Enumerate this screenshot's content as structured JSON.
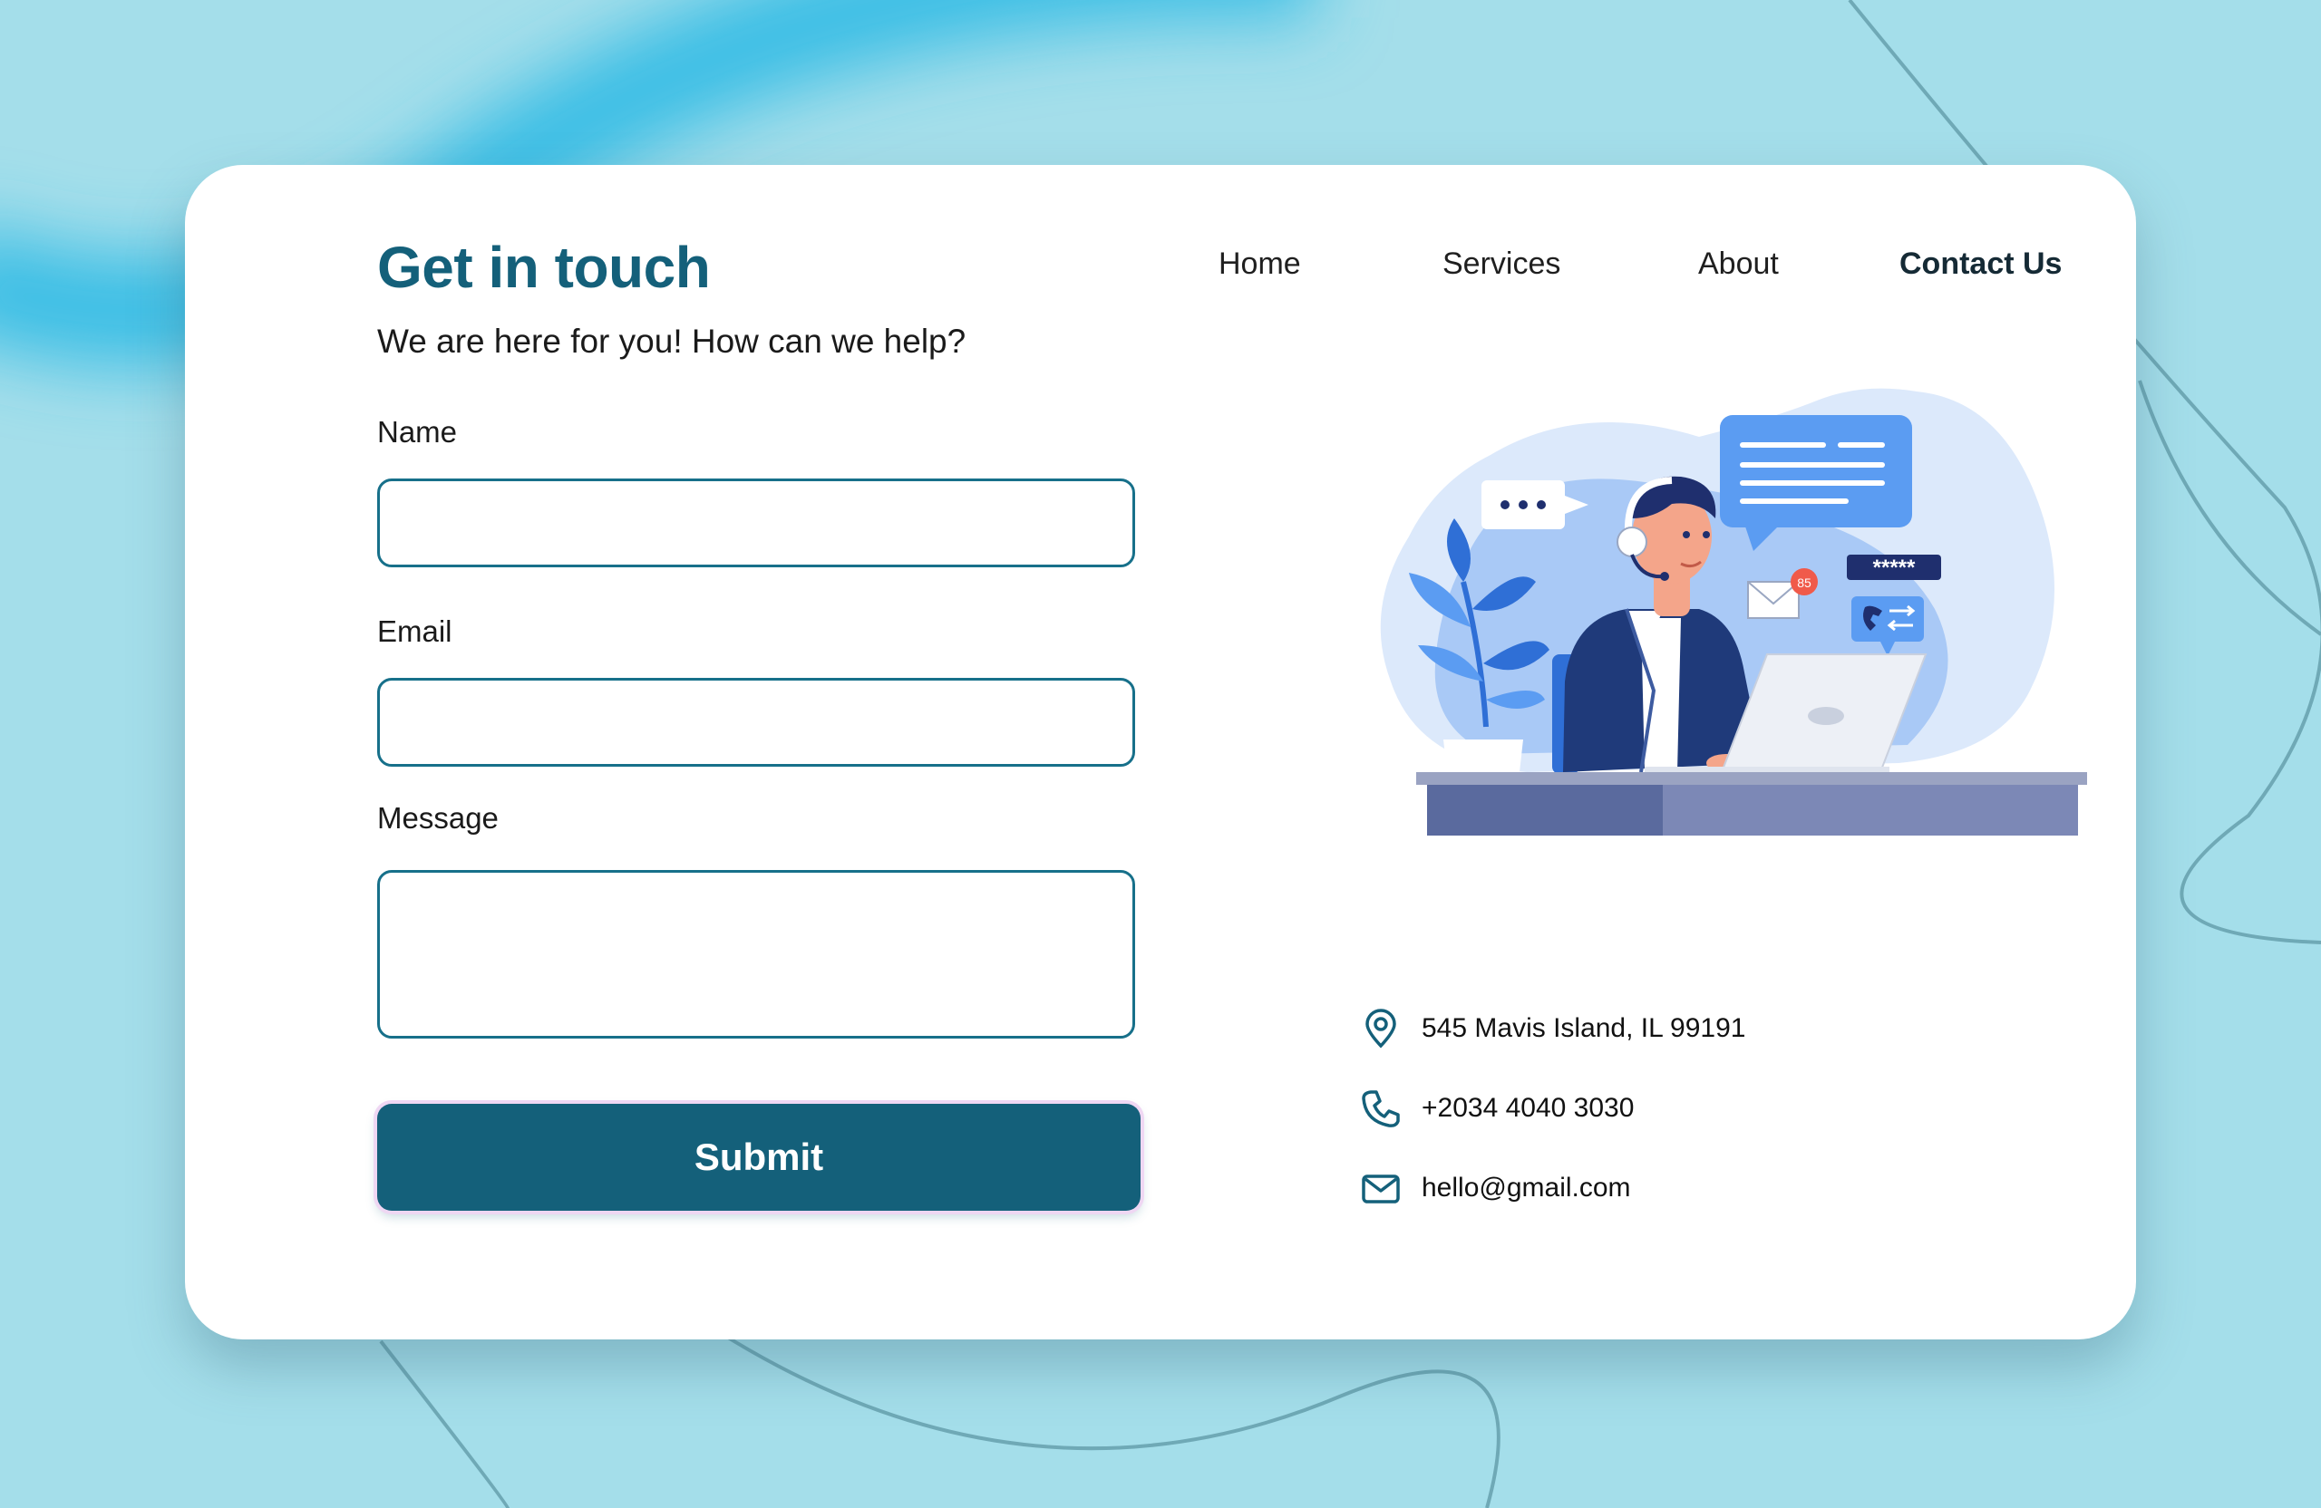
{
  "header": {
    "title": "Get in touch",
    "subtitle": "We are here for you! How can we help?"
  },
  "nav": {
    "items": [
      {
        "label": "Home"
      },
      {
        "label": "Services"
      },
      {
        "label": "About"
      },
      {
        "label": "Contact Us",
        "active": true
      }
    ]
  },
  "form": {
    "name_label": "Name",
    "name_value": "",
    "email_label": "Email",
    "email_value": "",
    "message_label": "Message",
    "message_value": "",
    "submit_label": "Submit"
  },
  "illustration": {
    "password_mask": "*****",
    "notification_count": "85"
  },
  "contact": {
    "address": "545 Mavis Island, IL 99191",
    "phone": "+2034 4040 3030",
    "email": "hello@gmail.com"
  },
  "colors": {
    "background": "#a4deea",
    "card": "#ffffff",
    "primary": "#14607a",
    "accent_blue": "#5b9cf2"
  }
}
